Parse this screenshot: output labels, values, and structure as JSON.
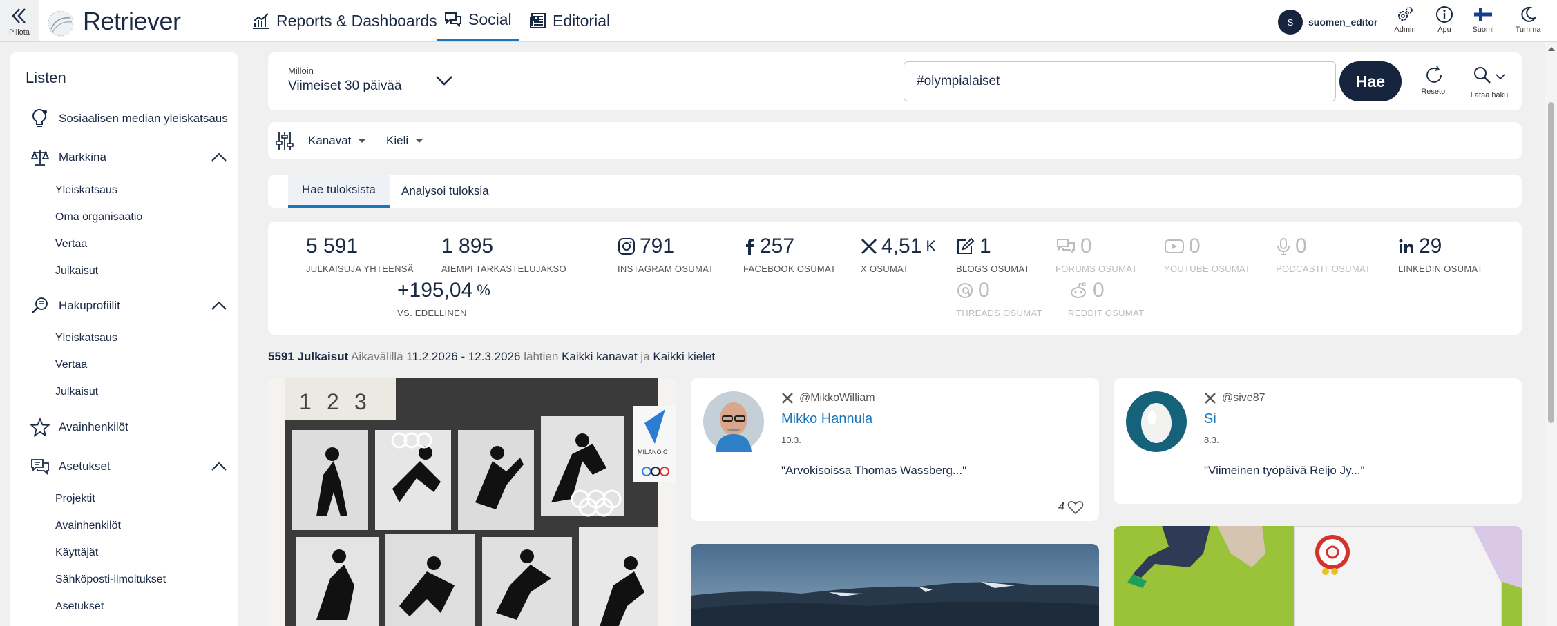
{
  "topbar": {
    "hide_label": "Piilota",
    "logo_text": "Retriever",
    "nav": [
      {
        "label": "Reports & Dashboards",
        "icon": "bar-chart-icon"
      },
      {
        "label": "Social",
        "icon": "chat-bubbles-icon",
        "active": true
      },
      {
        "label": "Editorial",
        "icon": "newspaper-icon"
      }
    ],
    "user": {
      "initial": "S",
      "name": "suomen_editor"
    },
    "tools": [
      {
        "label": "Admin",
        "icon": "gears-icon"
      },
      {
        "label": "Apu",
        "icon": "info-icon"
      },
      {
        "label": "Suomi",
        "icon": "finland-flag-icon"
      },
      {
        "label": "Tumma",
        "icon": "moon-icon"
      }
    ]
  },
  "sidebar": {
    "title": "Listen",
    "overview": "Sosiaalisen median yleiskatsaus",
    "sections": [
      {
        "label": "Markkina",
        "icon": "scales-icon",
        "items": [
          "Yleiskatsaus",
          "Oma organisaatio",
          "Vertaa",
          "Julkaisut"
        ]
      },
      {
        "label": "Hakuprofiilit",
        "icon": "search-chat-icon",
        "items": [
          "Yleiskatsaus",
          "Vertaa",
          "Julkaisut"
        ]
      }
    ],
    "key_people": "Avainhenkilöt",
    "settings": {
      "label": "Asetukset",
      "icon": "chat-settings-icon",
      "items": [
        "Projektit",
        "Avainhenkilöt",
        "Käyttäjät",
        "Sähköposti-ilmoitukset",
        "Asetukset"
      ]
    }
  },
  "search": {
    "when_label": "Milloin",
    "when_value": "Viimeiset 30 päivää",
    "query": "#olympialaiset",
    "submit_label": "Hae",
    "reset_label": "Resetoi",
    "load_label": "Lataa haku"
  },
  "filters": {
    "channels": "Kanavat",
    "language": "Kieli"
  },
  "result_tabs": [
    "Hae tuloksista",
    "Analysoi tuloksia"
  ],
  "stats": {
    "total": {
      "value": "5 591",
      "label": "JULKAISUJA YHTEENSÄ"
    },
    "previous": {
      "value": "1 895",
      "label": "AIEMPI TARKASTELUJAKSO"
    },
    "change": {
      "value": "+195,04",
      "unit": "%",
      "label": "VS. EDELLINEN"
    },
    "channels": [
      {
        "value": "791",
        "unit": "",
        "label": "INSTAGRAM OSUMAT",
        "icon": "instagram-icon",
        "dim": false
      },
      {
        "value": "257",
        "unit": "",
        "label": "FACEBOOK OSUMAT",
        "icon": "facebook-icon",
        "dim": false
      },
      {
        "value": "4,51",
        "unit": "K",
        "label": "X OSUMAT",
        "icon": "x-icon",
        "dim": false
      },
      {
        "value": "1",
        "unit": "",
        "label": "BLOGS OSUMAT",
        "icon": "blog-edit-icon",
        "dim": false
      },
      {
        "value": "0",
        "unit": "",
        "label": "FORUMS OSUMAT",
        "icon": "forums-icon",
        "dim": true
      },
      {
        "value": "0",
        "unit": "",
        "label": "YOUTUBE OSUMAT",
        "icon": "youtube-icon",
        "dim": true
      },
      {
        "value": "0",
        "unit": "",
        "label": "PODCASTIT OSUMAT",
        "icon": "microphone-icon",
        "dim": true
      },
      {
        "value": "29",
        "unit": "",
        "label": "LINKEDIN OSUMAT",
        "icon": "linkedin-icon",
        "dim": false
      },
      {
        "value": "0",
        "unit": "",
        "label": "THREADS OSUMAT",
        "icon": "threads-icon",
        "dim": true
      },
      {
        "value": "0",
        "unit": "",
        "label": "REDDIT OSUMAT",
        "icon": "reddit-icon",
        "dim": true
      }
    ]
  },
  "summary": {
    "count": "5591 Julkaisut",
    "period_label": "Aikavälillä",
    "period": "11.2.2026 - 12.3.2026",
    "sources_label": "lähtien",
    "channels": "Kaikki kanavat",
    "and": "ja",
    "languages": "Kaikki kielet"
  },
  "posts": [
    {
      "handle": "@MikkoWilliam",
      "name": "Mikko Hannula",
      "date": "10.3.",
      "text": "\"Arvokisoissa Thomas Wassberg...\"",
      "likes": "4"
    },
    {
      "handle": "@sive87",
      "name": "Si",
      "date": "8.3.",
      "text": "\"Viimeinen työpäivä Reijo Jy...\""
    }
  ],
  "colors": {
    "accent": "#1b75bb",
    "navy": "#16243d",
    "background": "#f0f0f0"
  }
}
